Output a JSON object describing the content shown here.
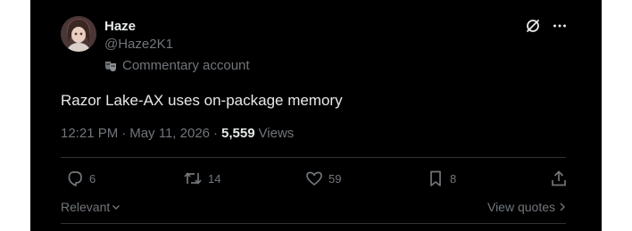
{
  "post": {
    "author_name": "Haze",
    "author_handle": "@Haze2K1",
    "account_label": "Commentary account",
    "text": "Razor Lake-AX uses on-package memory",
    "time": "12:21 PM",
    "separator_1": "·",
    "date": "May 11, 2026",
    "separator_2": "·",
    "views_count": "5,559",
    "views_label": "Views"
  },
  "actions": {
    "replies": "6",
    "reposts": "14",
    "likes": "59",
    "bookmarks": "8"
  },
  "footer": {
    "sort_label": "Relevant",
    "quotes_label": "View quotes"
  },
  "colors": {
    "background": "#000000",
    "text_primary": "#e7e9ea",
    "text_secondary": "#71767b",
    "divider": "#2f3336"
  },
  "icons": [
    "grok-icon",
    "more-icon",
    "comedy-mask-icon",
    "reply-icon",
    "repost-icon",
    "like-icon",
    "bookmark-icon",
    "share-icon",
    "chevron-down-icon",
    "chevron-right-icon"
  ]
}
